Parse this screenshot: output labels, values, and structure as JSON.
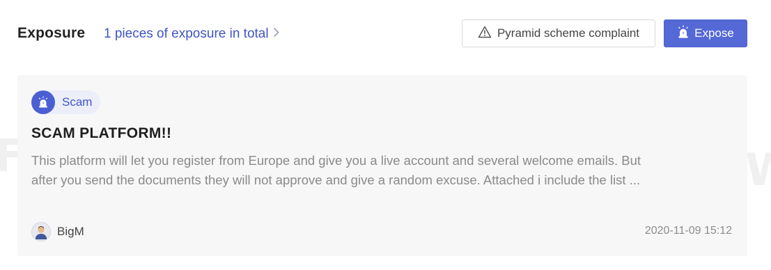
{
  "header": {
    "title": "Exposure",
    "count_link": "1 pieces of exposure in total",
    "complaint_button": "Pyramid scheme complaint",
    "expose_button": "Expose"
  },
  "post": {
    "tag": "Scam",
    "title": "SCAM PLATFORM!!",
    "body_lines": [
      "This platform will let you register from Europe and give you a live account and several welcome emails. But",
      "after you send the documents they will not approve and give a random excuse. Attached i include the list ..."
    ],
    "author": "BigM",
    "timestamp": "2020-11-09 15:12"
  },
  "colors": {
    "accent": "#5468d6",
    "link": "#3e55c4"
  },
  "icons": {
    "complaint": "warning-triangle-icon",
    "expose": "siren-icon",
    "tag": "siren-icon",
    "avatar": "user-avatar-icon",
    "count_link": "chevron-right-icon"
  }
}
